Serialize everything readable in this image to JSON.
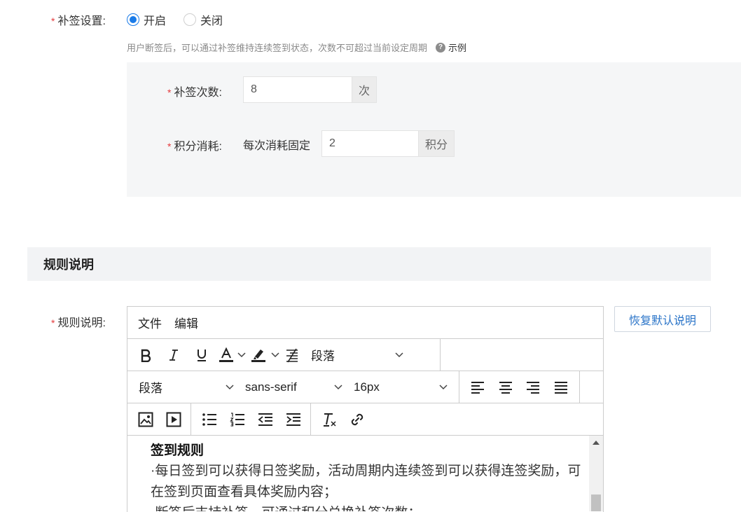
{
  "supplement": {
    "label": "补签设置:",
    "options": [
      "开启",
      "关闭"
    ],
    "selected": "开启",
    "hint": "用户断签后，可以通过补签维持连续签到状态，次数不可超过当前设定周期",
    "example_label": "示例",
    "count": {
      "label": "补签次数:",
      "value": "8",
      "unit": "次"
    },
    "points": {
      "label": "积分消耗:",
      "prefix": "每次消耗固定",
      "value": "2",
      "unit": "积分"
    }
  },
  "rules_section": {
    "title": "规则说明",
    "field_label": "规则说明:",
    "reset_button": "恢复默认说明"
  },
  "editor": {
    "menu": [
      "文件",
      "编辑"
    ],
    "block_format_1": "段落",
    "block_format_2": "段落",
    "font_family": "sans-serif",
    "font_size": "16px",
    "content": {
      "title": "签到规则",
      "line1": "·每日签到可以获得日签奖励，活动周期内连续签到可以获得连签奖励，可在签到页面查看具体奖励内容；",
      "line2": "·断签后支持补签，可通过积分兑换补签次数；"
    }
  }
}
